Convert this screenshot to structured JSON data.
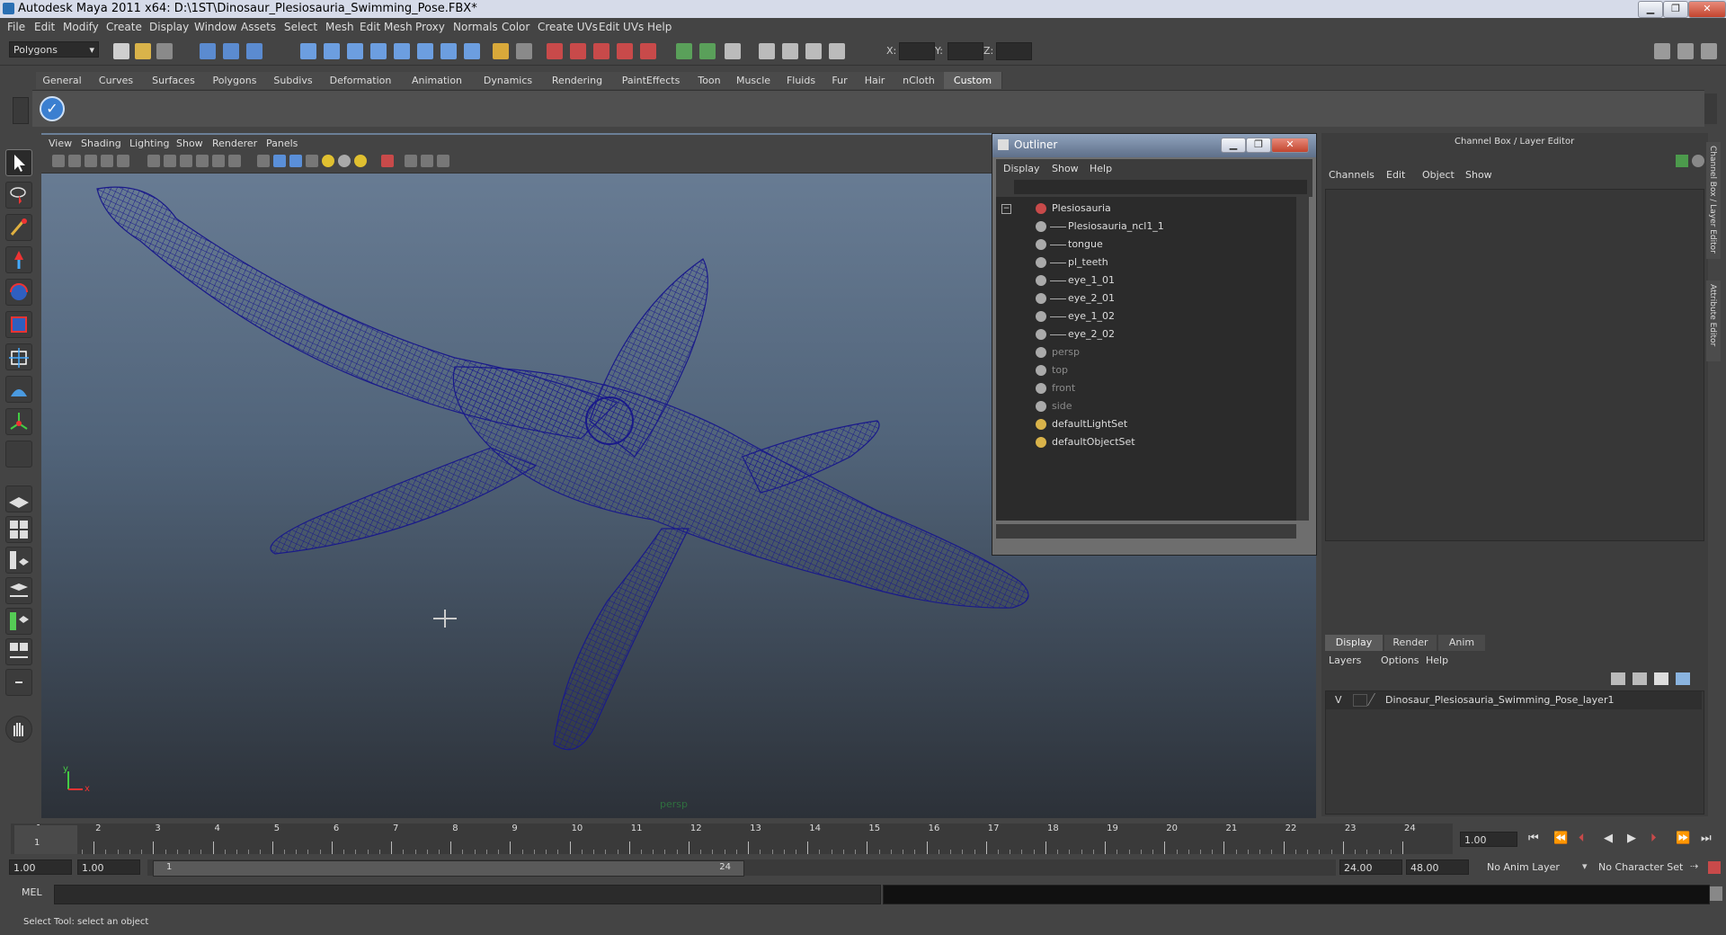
{
  "window": {
    "title": "Autodesk Maya 2011 x64: D:\\1ST\\Dinosaur_Plesiosauria_Swimming_Pose.FBX*"
  },
  "menubar": [
    "File",
    "Edit",
    "Modify",
    "Create",
    "Display",
    "Window",
    "Assets",
    "Select",
    "Mesh",
    "Edit Mesh",
    "Proxy",
    "Normals",
    "Color",
    "Create UVs",
    "Edit UVs",
    "Help"
  ],
  "statusline": {
    "menuset": "Polygons",
    "x_label": "X:",
    "y_label": "Y:",
    "z_label": "Z:"
  },
  "shelf": {
    "tabs": [
      "General",
      "Curves",
      "Surfaces",
      "Polygons",
      "Subdivs",
      "Deformation",
      "Animation",
      "Dynamics",
      "Rendering",
      "PaintEffects",
      "Toon",
      "Muscle",
      "Fluids",
      "Fur",
      "Hair",
      "nCloth",
      "Custom"
    ],
    "active_tab": "Custom"
  },
  "viewport": {
    "menus": [
      "View",
      "Shading",
      "Lighting",
      "Show",
      "Renderer",
      "Panels"
    ],
    "camera_label": "persp",
    "axis_y": "y",
    "axis_x": "x",
    "wire_color": "#1a1a8a"
  },
  "outliner": {
    "title": "Outliner",
    "menus": [
      "Display",
      "Show",
      "Help"
    ],
    "items": [
      {
        "label": "Plesiosauria",
        "depth": 0,
        "dim": false
      },
      {
        "label": "Plesiosauria_ncl1_1",
        "depth": 1,
        "dim": false
      },
      {
        "label": "tongue",
        "depth": 1,
        "dim": false
      },
      {
        "label": "pl_teeth",
        "depth": 1,
        "dim": false
      },
      {
        "label": "eye_1_01",
        "depth": 1,
        "dim": false
      },
      {
        "label": "eye_2_01",
        "depth": 1,
        "dim": false
      },
      {
        "label": "eye_1_02",
        "depth": 1,
        "dim": false
      },
      {
        "label": "eye_2_02",
        "depth": 1,
        "dim": false
      },
      {
        "label": "persp",
        "depth": 0,
        "dim": true
      },
      {
        "label": "top",
        "depth": 0,
        "dim": true
      },
      {
        "label": "front",
        "depth": 0,
        "dim": true
      },
      {
        "label": "side",
        "depth": 0,
        "dim": true
      },
      {
        "label": "defaultLightSet",
        "depth": 0,
        "dim": false
      },
      {
        "label": "defaultObjectSet",
        "depth": 0,
        "dim": false
      }
    ]
  },
  "channelbox": {
    "title": "Channel Box / Layer Editor",
    "menus": [
      "Channels",
      "Edit",
      "Object",
      "Show"
    ],
    "side_tabs": [
      "Channel Box / Layer Editor",
      "Attribute Editor"
    ]
  },
  "layer_editor": {
    "tabs": [
      "Display",
      "Render",
      "Anim"
    ],
    "active_tab": "Display",
    "menus": [
      "Layers",
      "Options",
      "Help"
    ],
    "layer_visibility": "V",
    "layer_name": "Dinosaur_Plesiosauria_Swimming_Pose_layer1"
  },
  "timeline": {
    "frames": [
      "1",
      "2",
      "3",
      "4",
      "5",
      "6",
      "7",
      "8",
      "9",
      "10",
      "11",
      "12",
      "13",
      "14",
      "15",
      "16",
      "17",
      "18",
      "19",
      "20",
      "21",
      "22",
      "23",
      "24"
    ],
    "current_frame": "1",
    "current_time_field": "1.00"
  },
  "rangeslider": {
    "start_time": "1.00",
    "playback_start": "1.00",
    "range_start_label": "1",
    "range_end_label": "24",
    "playback_end": "24.00",
    "end_time": "48.00",
    "anim_layer": "No Anim Layer",
    "character_set": "No Character Set"
  },
  "commandline": {
    "label": "MEL"
  },
  "helpline": {
    "text": "Select Tool: select an object"
  }
}
